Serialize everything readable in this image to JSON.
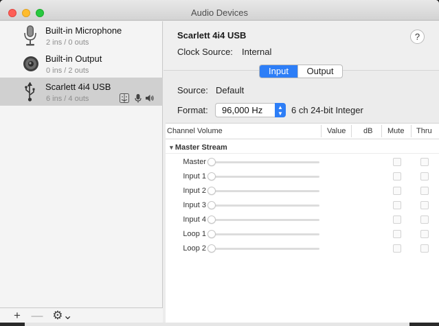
{
  "window": {
    "title": "Audio Devices"
  },
  "sidebar": {
    "devices": [
      {
        "name": "Built-in Microphone",
        "io": "2 ins / 0 outs",
        "icon": "microphone-icon"
      },
      {
        "name": "Built-in Output",
        "io": "0 ins / 2 outs",
        "icon": "speaker-icon"
      },
      {
        "name": "Scarlett 4i4 USB",
        "io": "6 ins / 4 outs",
        "icon": "usb-icon",
        "selected": true
      }
    ],
    "badges": [
      "finder-icon",
      "microphone-small-icon",
      "speaker-small-icon"
    ],
    "toolbar": {
      "add": "+",
      "remove": "—",
      "gear": "⚙⌄"
    }
  },
  "detail": {
    "title": "Scarlett 4i4 USB",
    "help": "?",
    "clock_label": "Clock Source:",
    "clock_value": "Internal",
    "tabs": {
      "input": "Input",
      "output": "Output",
      "selected": "Input"
    },
    "source_label": "Source:",
    "source_value": "Default",
    "format_label": "Format:",
    "format_value": "96,000 Hz",
    "format_desc": "6 ch 24-bit Integer"
  },
  "table": {
    "headers": {
      "channel": "Channel Volume",
      "value": "Value",
      "db": "dB",
      "mute": "Mute",
      "thru": "Thru"
    },
    "group": "Master Stream",
    "rows": [
      {
        "label": "Master",
        "level": 0
      },
      {
        "label": "Input 1",
        "level": 0
      },
      {
        "label": "Input 2",
        "level": 0
      },
      {
        "label": "Input 3",
        "level": 0
      },
      {
        "label": "Input 4",
        "level": 0
      },
      {
        "label": "Loop 1",
        "level": 0
      },
      {
        "label": "Loop 2",
        "level": 0
      }
    ]
  },
  "colors": {
    "accent": "#2d7ef7",
    "selection": "#d0d0d0"
  }
}
